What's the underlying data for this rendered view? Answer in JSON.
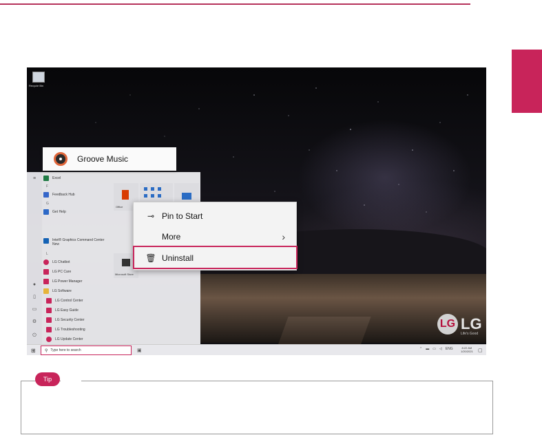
{
  "colors": {
    "accent": "#c8245a",
    "rule": "#b5315a"
  },
  "desktop": {
    "recycle_bin_label": "Recycle Bin",
    "lg_mark": "LG",
    "lg_brand": "LG",
    "lg_slogan": "Life's Good"
  },
  "start_menu": {
    "rail_icons": [
      "menu-icon",
      "user-icon",
      "document-icon",
      "pictures-icon",
      "settings-icon",
      "power-icon"
    ],
    "letters": {
      "f": "F",
      "g": "G",
      "i": "I",
      "l": "L"
    },
    "apps": [
      {
        "label": "Excel",
        "icon": "excel-icon",
        "color": "#1f7a44"
      },
      {
        "label": "Feedback Hub",
        "icon": "feedback-hub-icon",
        "color": "#3566c9"
      },
      {
        "label": "Get Help",
        "icon": "get-help-icon",
        "color": "#2c68c6"
      },
      {
        "label": "Intel® Graphics Command Center",
        "sub": "New",
        "icon": "intel-graphics-icon",
        "color": "#1462b4"
      },
      {
        "label": "LG Chatbot",
        "icon": "lg-chatbot-icon",
        "color": "#c8245a"
      },
      {
        "label": "LG PC Care",
        "icon": "lg-pc-care-icon",
        "color": "#c8245a"
      },
      {
        "label": "LG Power Manager",
        "icon": "lg-power-manager-icon",
        "color": "#c8245a"
      },
      {
        "label": "LG Software",
        "icon": "folder-icon",
        "color": "#e6b43a"
      },
      {
        "label": "LG Control Center",
        "icon": "lg-control-center-icon",
        "color": "#c8245a"
      },
      {
        "label": "LG Easy Guide",
        "icon": "lg-easy-guide-icon",
        "color": "#c8245a"
      },
      {
        "label": "LG Security Center",
        "icon": "lg-security-center-icon",
        "color": "#c8245a"
      },
      {
        "label": "LG Troubleshooting",
        "icon": "lg-troubleshooting-icon",
        "color": "#c8245a"
      },
      {
        "label": "LG Update Center",
        "icon": "lg-update-center-icon",
        "color": "#c8245a"
      }
    ],
    "tiles": {
      "office": "Office",
      "store": "Microsoft Store"
    }
  },
  "selected_app": {
    "label": "Groove Music",
    "icon": "groove-music-icon"
  },
  "context_menu": {
    "items": [
      {
        "label": "Pin to Start",
        "icon": "pin-icon"
      },
      {
        "label": "More",
        "icon": "",
        "arrow": "chevron-right-icon"
      },
      {
        "label": "Uninstall",
        "icon": "trash-icon"
      }
    ]
  },
  "taskbar": {
    "search_placeholder": "Type here to search",
    "tray_lang": "ENG",
    "clock_time": "8:22 AM",
    "clock_date": "1/20/2021"
  },
  "tip": {
    "badge": "Tip"
  }
}
